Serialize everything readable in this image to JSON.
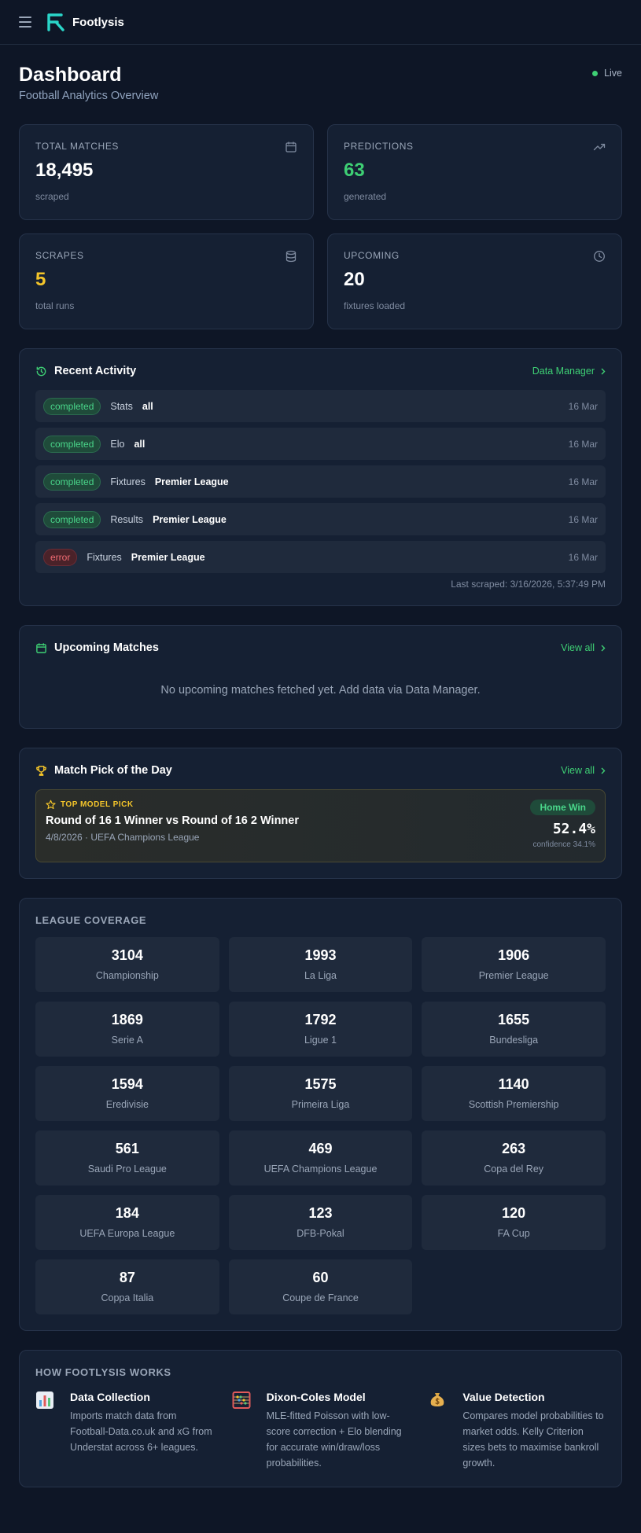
{
  "header": {
    "brand": "Footlysis",
    "menu_icon": "hamburger-menu-icon",
    "logo_icon": "footlysis-logo-icon"
  },
  "page": {
    "title": "Dashboard",
    "subtitle": "Football Analytics Overview",
    "live_label": "Live",
    "live_color": "#3ecf74"
  },
  "stats": [
    {
      "label": "TOTAL MATCHES",
      "value": "18,495",
      "note": "scraped",
      "icon": "calendar-icon"
    },
    {
      "label": "PREDICTIONS",
      "value": "63",
      "note": "generated",
      "icon": "trending-up-icon",
      "color": "#3ecf74"
    },
    {
      "label": "SCRAPES",
      "value": "5",
      "note": "total runs",
      "icon": "database-icon",
      "color": "#f4c52a"
    },
    {
      "label": "UPCOMING",
      "value": "20",
      "note": "fixtures loaded",
      "icon": "clock-icon"
    }
  ],
  "recent_activity": {
    "title": "Recent Activity",
    "link": "Data Manager",
    "items": [
      {
        "status": "completed",
        "type": "Stats",
        "scope": "all",
        "date": "16 Mar"
      },
      {
        "status": "completed",
        "type": "Elo",
        "scope": "all",
        "date": "16 Mar"
      },
      {
        "status": "completed",
        "type": "Fixtures",
        "scope": "Premier League",
        "date": "16 Mar"
      },
      {
        "status": "completed",
        "type": "Results",
        "scope": "Premier League",
        "date": "16 Mar"
      },
      {
        "status": "error",
        "type": "Fixtures",
        "scope": "Premier League",
        "date": "16 Mar"
      }
    ],
    "last_scraped": "Last scraped: 3/16/2026, 5:37:49 PM"
  },
  "upcoming": {
    "title": "Upcoming Matches",
    "link": "View all",
    "empty_message": "No upcoming matches fetched yet. Add data via Data Manager."
  },
  "pick": {
    "title": "Match Pick of the Day",
    "link": "View all",
    "tag": "TOP MODEL PICK",
    "match": "Round of 16 1 Winner vs Round of 16 2 Winner",
    "meta": "4/8/2026 · UEFA Champions League",
    "outcome": "Home Win",
    "probability": "52.4%",
    "confidence": "confidence 34.1%"
  },
  "league_coverage": {
    "title": "LEAGUE COVERAGE",
    "leagues": [
      {
        "count": "3104",
        "name": "Championship"
      },
      {
        "count": "1993",
        "name": "La Liga"
      },
      {
        "count": "1906",
        "name": "Premier League"
      },
      {
        "count": "1869",
        "name": "Serie A"
      },
      {
        "count": "1792",
        "name": "Ligue 1"
      },
      {
        "count": "1655",
        "name": "Bundesliga"
      },
      {
        "count": "1594",
        "name": "Eredivisie"
      },
      {
        "count": "1575",
        "name": "Primeira Liga"
      },
      {
        "count": "1140",
        "name": "Scottish Premiership"
      },
      {
        "count": "561",
        "name": "Saudi Pro League"
      },
      {
        "count": "469",
        "name": "UEFA Champions League"
      },
      {
        "count": "263",
        "name": "Copa del Rey"
      },
      {
        "count": "184",
        "name": "UEFA Europa League"
      },
      {
        "count": "123",
        "name": "DFB-Pokal"
      },
      {
        "count": "120",
        "name": "FA Cup"
      },
      {
        "count": "87",
        "name": "Coppa Italia"
      },
      {
        "count": "60",
        "name": "Coupe de France"
      }
    ]
  },
  "how_it_works": {
    "title": "HOW FOOTLYSIS WORKS",
    "items": [
      {
        "icon": "bar-chart-icon",
        "title": "Data Collection",
        "desc": "Imports match data from Football-Data.co.uk and xG from Understat across 6+ leagues."
      },
      {
        "icon": "abacus-icon",
        "title": "Dixon-Coles Model",
        "desc": "MLE-fitted Poisson with low-score correction + Elo blending for accurate win/draw/loss probabilities."
      },
      {
        "icon": "money-bag-icon",
        "title": "Value Detection",
        "desc": "Compares model probabilities to market odds. Kelly Criterion sizes bets to maximise bankroll growth."
      }
    ]
  }
}
